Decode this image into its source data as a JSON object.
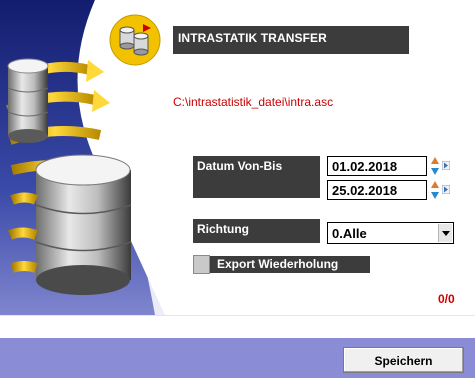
{
  "header": {
    "title": "INTRASTATIK TRANSFER"
  },
  "file": {
    "path": "C:\\intrastatistik_datei\\intra.asc"
  },
  "date_range": {
    "label": "Datum Von-Bis",
    "from": "01.02.2018",
    "to": "25.02.2018"
  },
  "direction": {
    "label": "Richtung",
    "selected": "0.Alle"
  },
  "export_repeat": {
    "label": "Export Wiederholung",
    "checked": false
  },
  "counter": "0/0",
  "footer": {
    "save_label": "Speichern"
  },
  "colors": {
    "accent_red": "#cc0000",
    "label_bg": "#3c3c3c",
    "footer_bg": "#8b8cd6",
    "banner_blue": "#1b2a8a",
    "arrow_yellow": "#f2c200"
  }
}
